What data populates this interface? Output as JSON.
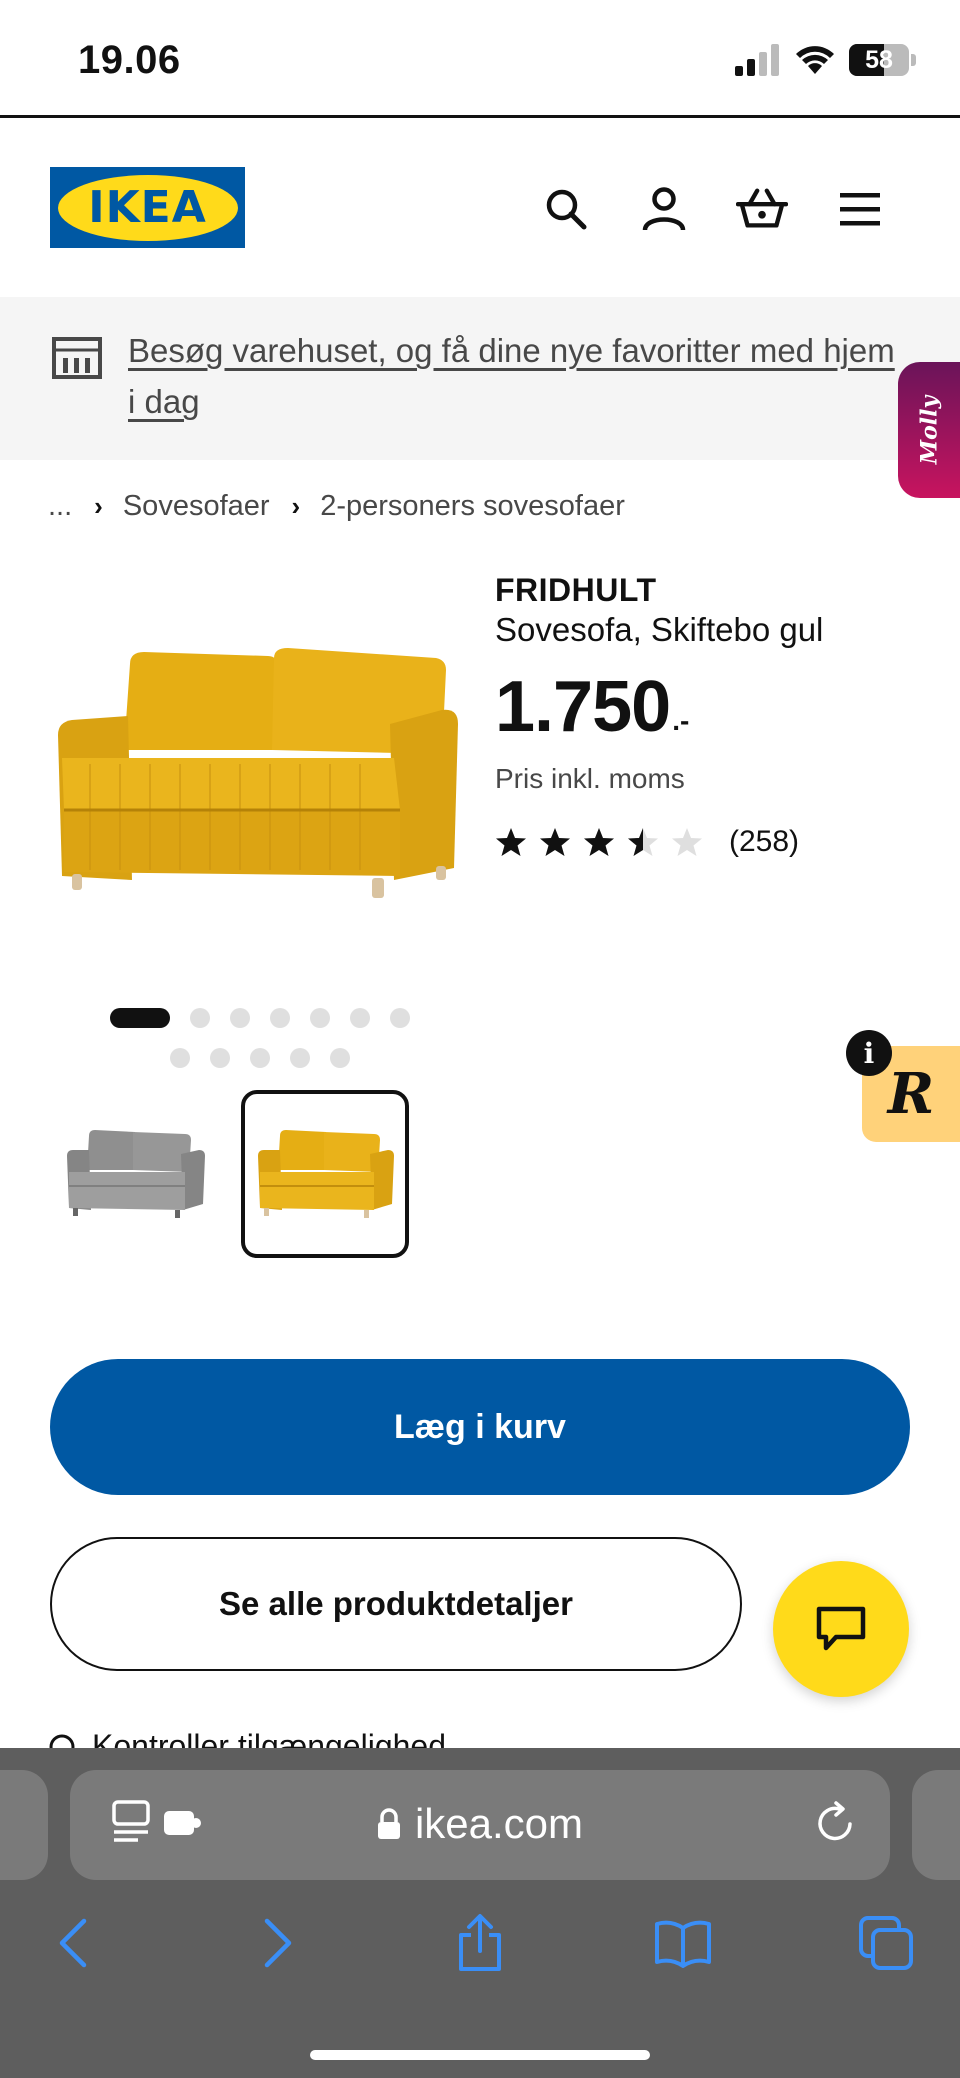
{
  "status_bar": {
    "time": "19.06",
    "battery": "58",
    "battery_level": 0.58
  },
  "header": {
    "logo_text": "IKEA",
    "icons": [
      "search-icon",
      "account-icon",
      "basket-icon",
      "menu-icon"
    ]
  },
  "banner": {
    "text": "Besøg varehuset, og få dine nye favoritter med hjem i dag"
  },
  "molly": {
    "label": "Molly"
  },
  "breadcrumb": {
    "ellipsis": "...",
    "items": [
      "Sovesofaer",
      "2-personers sovesofaer"
    ]
  },
  "product": {
    "name": "FRIDHULT",
    "description": "Sovesofa, Skiftebo gul",
    "price": "1.750",
    "price_suffix": ".-",
    "price_note": "Pris inkl. moms",
    "rating": 3.5,
    "rating_max": 5,
    "review_count": "(258)"
  },
  "gallery": {
    "dot_count": 12,
    "active_index": 0,
    "thumbnails": [
      "gray",
      "yellow"
    ],
    "selected_thumbnail": 1
  },
  "r_badge": {
    "letter": "R",
    "info": "i"
  },
  "buttons": {
    "add_to_cart": "Læg i kurv",
    "all_details": "Se alle produktdetaljer"
  },
  "availability": {
    "text": "Kontroller tilgængelighed"
  },
  "browser": {
    "url": "ikea.com"
  },
  "colors": {
    "ikea_blue": "#0058a3",
    "ikea_yellow": "#ffda1a",
    "sofa_yellow": "#e9b21a",
    "molly_pink": "#c8145f",
    "browser_blue": "#3a8ef6"
  }
}
